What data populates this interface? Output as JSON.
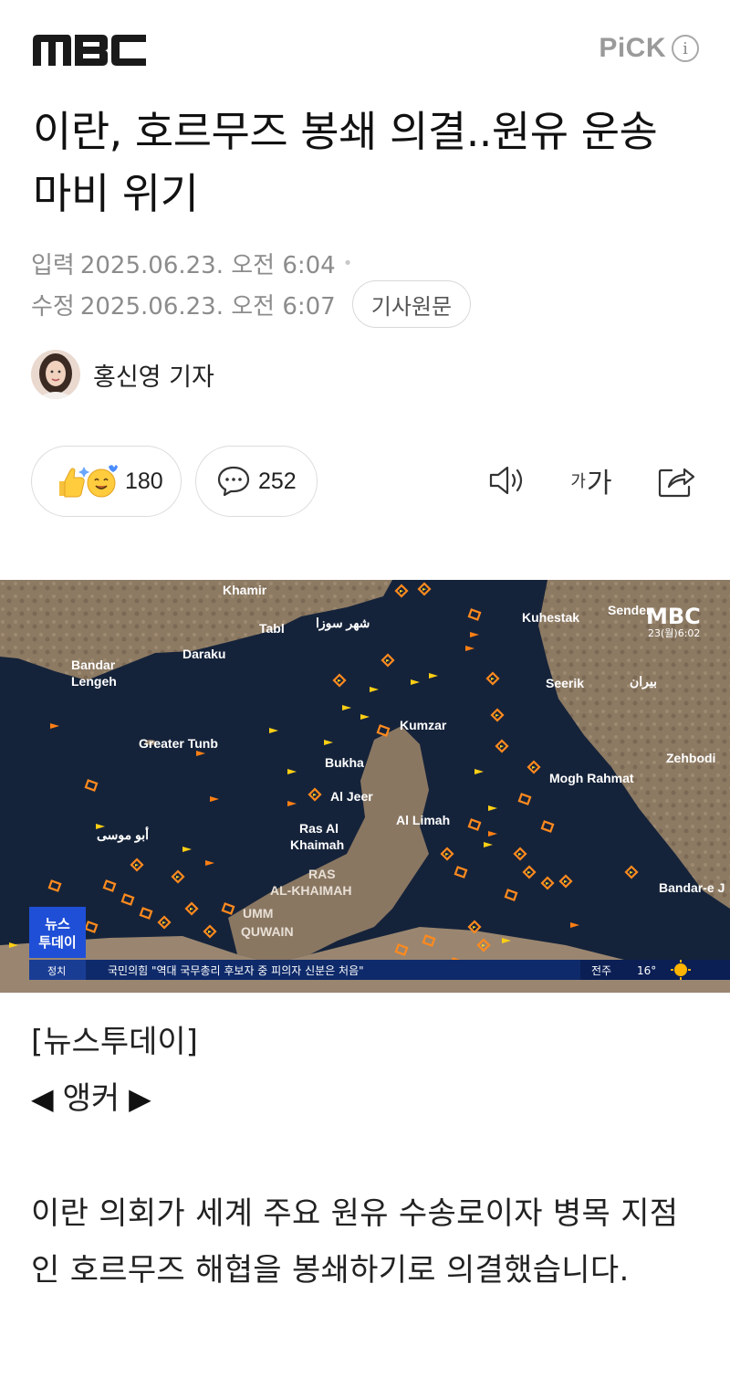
{
  "header": {
    "brand": "MBC",
    "pick_label": "PiCK",
    "info_icon": "i"
  },
  "article": {
    "title": "이란, 호르무즈 봉쇄 의결..원유 운송 마비 위기",
    "published_label": "입력",
    "published": "2025.06.23. 오전 6:04",
    "modified_label": "수정",
    "modified": "2025.06.23. 오전 6:07",
    "original_button": "기사원문",
    "author": "홍신영 기자"
  },
  "actions": {
    "reactions_count": "180",
    "comments_count": "252",
    "font_small": "가",
    "font_large": "가"
  },
  "photo": {
    "watermark": "MBC",
    "broadcast_time": "23(월)6:02",
    "program_badge_line1": "뉴스",
    "program_badge_line2": "투데이",
    "category": "정치",
    "ticker": "국민의힘 \"역대 국무총리 후보자 중 피의자 신분은 처음\"",
    "weather_city": "전주",
    "weather_temp": "16°",
    "map_labels": {
      "khamir": "Khamir",
      "tabl": "Tabl",
      "shahr_suza": "شهر سوزا",
      "bandar_lengeh": "Bandar Lengeh",
      "daraku": "Daraku",
      "greater_tunb": "Greater Tunb",
      "kumzar": "Kumzar",
      "bukha": "Bukha",
      "al_jeer": "Al Jeer",
      "ras_al_khaimah": "Ras Al Khaimah",
      "al_limah": "Al Limah",
      "abu_musa": "أبو موسى",
      "ras_al_khaimah_caps": "RAS AL-KHAIMAH",
      "umm_quwain": "UMM QUWAIN",
      "kuhestak": "Kuhestak",
      "sender": "Sender",
      "seerik": "Seerik",
      "biran": "بيران",
      "zehbodi": "Zehbodi",
      "mogh_rahmat": "Mogh Rahmat",
      "bandar_e": "Bandar-e J"
    }
  },
  "content": {
    "program_tag": "[뉴스투데이]",
    "anchor_label": "앵커",
    "paragraph": "이란 의회가 세계 주요 원유 수송로이자 병목 지점인 호르무즈 해협을 봉쇄하기로 의결했습니다."
  }
}
